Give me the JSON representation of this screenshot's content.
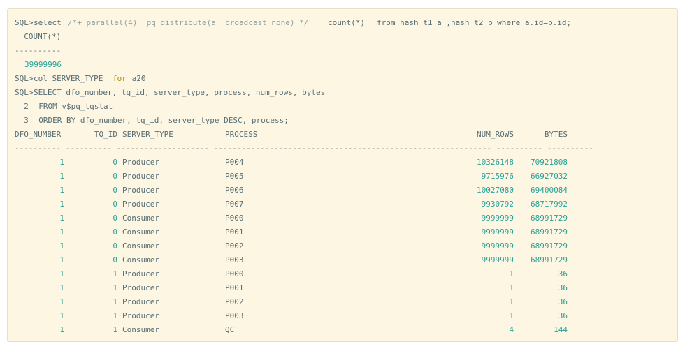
{
  "query1": {
    "prompt": "SQL>",
    "keyword_select": "select",
    "hint": "/*+ parallel(4)  pq_distribute(a  broadcast none) */",
    "func": "count(*)",
    "rest": "from hash_t1 a ,hash_t2 b where a.id=b.id;"
  },
  "result1": {
    "header": "  COUNT(*)",
    "divider": "----------",
    "value": "39999996"
  },
  "col_cmd": {
    "prompt": "SQL>",
    "text_a": "col SERVER_TYPE ",
    "kw_for": "for",
    "text_b": " a20"
  },
  "query2": {
    "line1_prompt": "SQL>",
    "line1": "SELECT dfo_number, tq_id, server_type, process, num_rows, bytes",
    "line2_num": "  2",
    "line2": "  FROM v$pq_tqstat",
    "line3_num": "  3",
    "line3": "  ORDER BY dfo_number, tq_id, server_type DESC, process;"
  },
  "table": {
    "headers": {
      "dfo_number": "DFO_NUMBER",
      "tq_id": "TQ_ID",
      "server_type": "SERVER_TYPE",
      "process": "PROCESS",
      "num_rows": "NUM_ROWS",
      "bytes": "BYTES"
    },
    "divider": "---------- ---------- -------------------- ------------------------------------------------------------ ---------- ----------",
    "rows": [
      {
        "dfo": "1",
        "tq": "0",
        "type": "Producer",
        "proc": "P004",
        "rows": "10326148",
        "bytes": "70921808"
      },
      {
        "dfo": "1",
        "tq": "0",
        "type": "Producer",
        "proc": "P005",
        "rows": "9715976",
        "bytes": "66927032"
      },
      {
        "dfo": "1",
        "tq": "0",
        "type": "Producer",
        "proc": "P006",
        "rows": "10027080",
        "bytes": "69400084"
      },
      {
        "dfo": "1",
        "tq": "0",
        "type": "Producer",
        "proc": "P007",
        "rows": "9930792",
        "bytes": "68717992"
      },
      {
        "dfo": "1",
        "tq": "0",
        "type": "Consumer",
        "proc": "P000",
        "rows": "9999999",
        "bytes": "68991729"
      },
      {
        "dfo": "1",
        "tq": "0",
        "type": "Consumer",
        "proc": "P001",
        "rows": "9999999",
        "bytes": "68991729"
      },
      {
        "dfo": "1",
        "tq": "0",
        "type": "Consumer",
        "proc": "P002",
        "rows": "9999999",
        "bytes": "68991729"
      },
      {
        "dfo": "1",
        "tq": "0",
        "type": "Consumer",
        "proc": "P003",
        "rows": "9999999",
        "bytes": "68991729"
      },
      {
        "dfo": "1",
        "tq": "1",
        "type": "Producer",
        "proc": "P000",
        "rows": "1",
        "bytes": "36"
      },
      {
        "dfo": "1",
        "tq": "1",
        "type": "Producer",
        "proc": "P001",
        "rows": "1",
        "bytes": "36"
      },
      {
        "dfo": "1",
        "tq": "1",
        "type": "Producer",
        "proc": "P002",
        "rows": "1",
        "bytes": "36"
      },
      {
        "dfo": "1",
        "tq": "1",
        "type": "Producer",
        "proc": "P003",
        "rows": "1",
        "bytes": "36"
      },
      {
        "dfo": "1",
        "tq": "1",
        "type": "Consumer",
        "proc": "QC",
        "rows": "4",
        "bytes": "144"
      }
    ]
  },
  "colors": {
    "background": "#fdf6e3",
    "text": "#586e75",
    "comment": "#93a1a1",
    "number": "#2aa198",
    "keyword_for": "#b58900"
  }
}
